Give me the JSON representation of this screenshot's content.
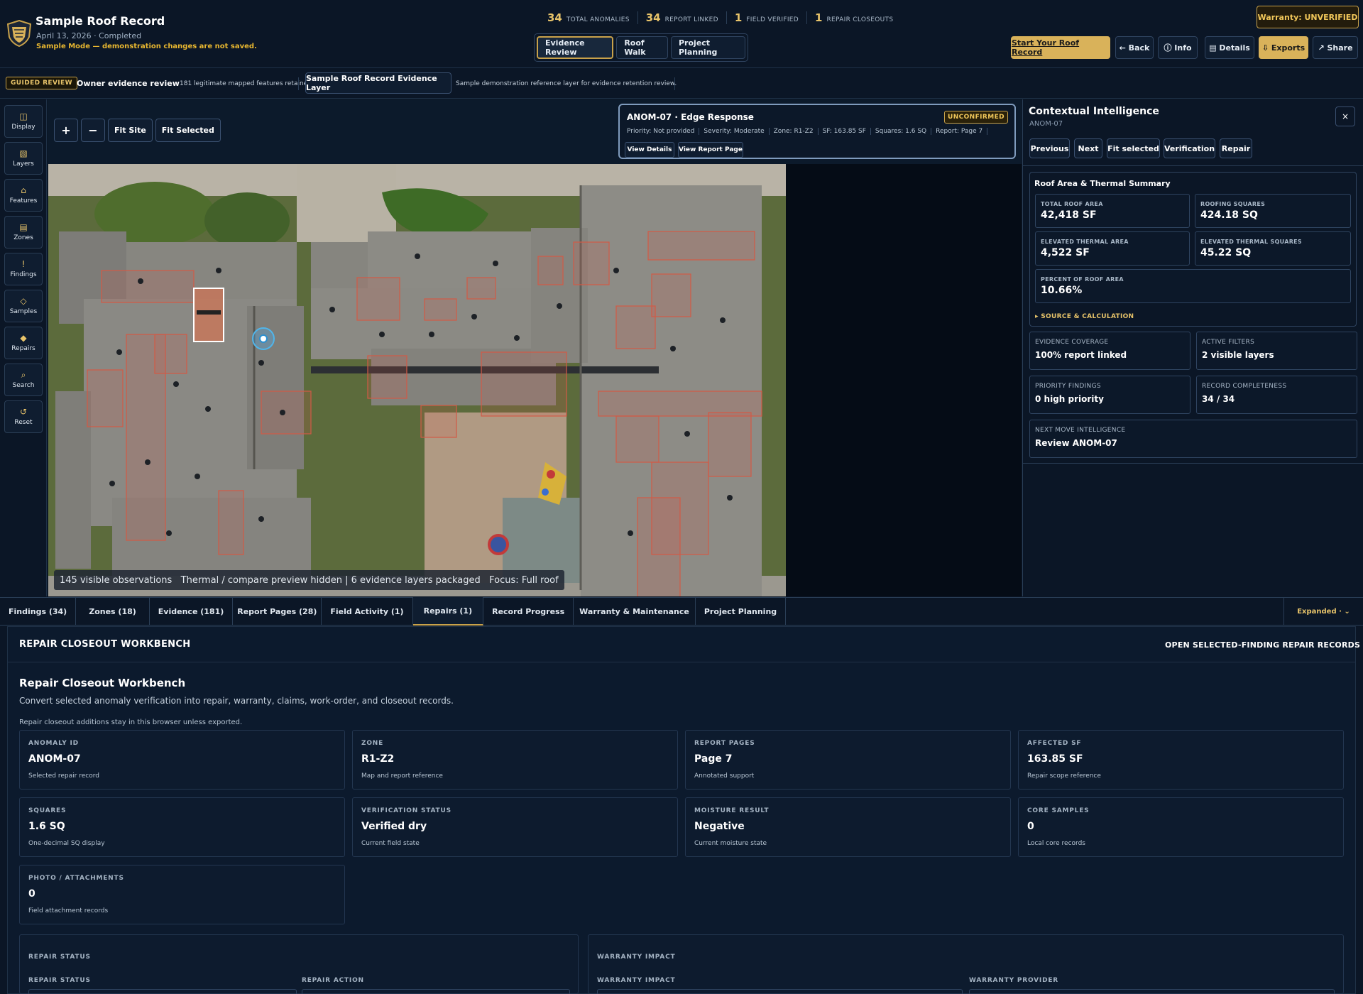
{
  "header": {
    "title": "Sample Roof Record",
    "date": "April 13, 2026 · Completed",
    "mode_note": "Sample Mode — demonstration changes are not saved.",
    "stats": [
      {
        "value": "34",
        "label": "TOTAL ANOMALIES"
      },
      {
        "value": "34",
        "label": "REPORT LINKED"
      },
      {
        "value": "1",
        "label": "FIELD VERIFIED"
      },
      {
        "value": "1",
        "label": "REPAIR CLOSEOUTS"
      }
    ],
    "modes": [
      "Evidence Review",
      "Roof Walk",
      "Project Planning"
    ],
    "warranty": "Warranty: UNVERIFIED",
    "start_btn": "Start Your Roof Record",
    "back": "← Back",
    "info": "ⓘ Info",
    "details": "▤ Details",
    "exports": "⇩ Exports",
    "share": "↗ Share"
  },
  "guided": {
    "badge": "GUIDED REVIEW",
    "title": "Owner evidence review",
    "sub": "181 legitimate mapped features retained",
    "layer_btn": "Sample Roof Record Evidence Layer",
    "layer_desc": "Sample demonstration reference layer for evidence retention review."
  },
  "toolbar": [
    {
      "icon": "◫",
      "label": "Display"
    },
    {
      "icon": "▧",
      "label": "Layers"
    },
    {
      "icon": "⌂",
      "label": "Features"
    },
    {
      "icon": "▤",
      "label": "Zones"
    },
    {
      "icon": "!",
      "label": "Findings"
    },
    {
      "icon": "◇",
      "label": "Samples"
    },
    {
      "icon": "◆",
      "label": "Repairs"
    },
    {
      "icon": "⌕",
      "label": "Search"
    },
    {
      "icon": "↺",
      "label": "Reset"
    }
  ],
  "map": {
    "zoom_in": "+",
    "zoom_out": "−",
    "fit_site": "Fit Site",
    "fit_selected": "Fit Selected",
    "status": "145 visible observations   Thermal / compare preview hidden | 6 evidence layers packaged   Focus: Full roof"
  },
  "anomaly": {
    "title": "ANOM-07 · Edge Response",
    "badge": "UNCONFIRMED",
    "meta": [
      "Priority: Not provided",
      "Severity: Moderate",
      "Zone: R1-Z2",
      "SF: 163.85 SF",
      "Squares: 1.6 SQ",
      "Report: Page 7"
    ],
    "view_details": "View Details",
    "view_report": "View Report Page"
  },
  "panel": {
    "title": "Contextual Intelligence",
    "sub": "ANOM-07",
    "close": "×",
    "buttons": [
      "Previous",
      "Next",
      "Fit selected",
      "Verification",
      "Repair"
    ],
    "summary_title": "Roof Area & Thermal Summary",
    "total_roof_area": {
      "k": "TOTAL ROOF AREA",
      "v": "42,418 SF"
    },
    "roofing_squares": {
      "k": "ROOFING SQUARES",
      "v": "424.18 SQ"
    },
    "elevated_area": {
      "k": "ELEVATED THERMAL AREA",
      "v": "4,522 SF"
    },
    "elevated_squares": {
      "k": "ELEVATED THERMAL SQUARES",
      "v": "45.22 SQ"
    },
    "percent": {
      "k": "PERCENT OF ROOF AREA",
      "v": "10.66%"
    },
    "source_calc": "▸ SOURCE & CALCULATION",
    "evidence_coverage": {
      "k": "EVIDENCE COVERAGE",
      "v": "100% report linked"
    },
    "active_filters": {
      "k": "ACTIVE FILTERS",
      "v": "2 visible layers"
    },
    "priority_findings": {
      "k": "PRIORITY FINDINGS",
      "v": "0 high priority"
    },
    "record_completeness": {
      "k": "RECORD COMPLETENESS",
      "v": "34 / 34"
    },
    "next_move": {
      "k": "NEXT MOVE INTELLIGENCE",
      "v": "Review ANOM-07"
    }
  },
  "tabs": [
    "Findings (34)",
    "Zones (18)",
    "Evidence (181)",
    "Report Pages (28)",
    "Field Activity (1)",
    "Repairs (1)",
    "Record Progress",
    "Warranty & Maintenance",
    "Project Planning"
  ],
  "expanded": "Expanded · ⌄",
  "workbench": {
    "header": "REPAIR CLOSEOUT WORKBENCH",
    "open_link": "OPEN SELECTED-FINDING REPAIR RECORDS",
    "title": "Repair Closeout Workbench",
    "desc": "Convert selected anomaly verification into repair, warranty, claims, work-order, and closeout records.",
    "note": "Repair closeout additions stay in this browser unless exported.",
    "cards": [
      {
        "k": "ANOMALY ID",
        "v": "ANOM-07",
        "s": "Selected repair record"
      },
      {
        "k": "ZONE",
        "v": "R1-Z2",
        "s": "Map and report reference"
      },
      {
        "k": "REPORT PAGES",
        "v": "Page 7",
        "s": "Annotated support"
      },
      {
        "k": "AFFECTED SF",
        "v": "163.85 SF",
        "s": "Repair scope reference"
      },
      {
        "k": "SQUARES",
        "v": "1.6 SQ",
        "s": "One-decimal SQ display"
      },
      {
        "k": "VERIFICATION STATUS",
        "v": "Verified dry",
        "s": "Current field state"
      },
      {
        "k": "MOISTURE RESULT",
        "v": "Negative",
        "s": "Current moisture state"
      },
      {
        "k": "CORE SAMPLES",
        "v": "0",
        "s": "Local core records"
      },
      {
        "k": "PHOTO / ATTACHMENTS",
        "v": "0",
        "s": "Field attachment records"
      }
    ],
    "repair_status_sec": "REPAIR STATUS",
    "repair_status_lbl": "REPAIR STATUS",
    "repair_action_lbl": "REPAIR ACTION",
    "warranty_sec": "WARRANTY IMPACT",
    "warranty_impact_lbl": "WARRANTY IMPACT",
    "warranty_provider_lbl": "WARRANTY PROVIDER"
  }
}
